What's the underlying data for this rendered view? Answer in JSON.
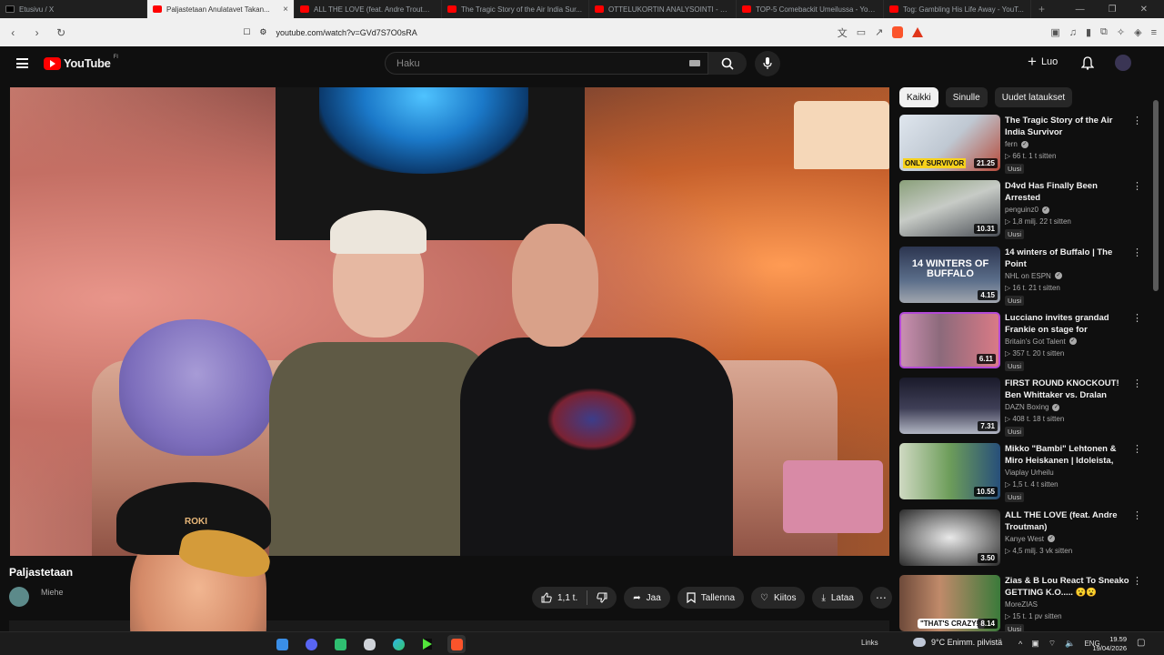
{
  "browser": {
    "tabs": [
      {
        "label": "Etusivu / X",
        "icon": "x-icon",
        "active": false
      },
      {
        "label": "Paljastetaan Anulatavet Takan...",
        "icon": "youtube-icon",
        "active": true
      },
      {
        "label": "ALL THE LOVE (feat. Andre Troutman...",
        "icon": "youtube-icon",
        "active": false
      },
      {
        "label": "The Tragic Story of the Air India Sur...",
        "icon": "youtube-icon",
        "active": false
      },
      {
        "label": "OTTELUKORTIN ANALYSOINTI - YouT...",
        "icon": "youtube-icon",
        "active": false
      },
      {
        "label": "TOP-5 Comebackit Umeilussa - YouT...",
        "icon": "youtube-icon",
        "active": false
      },
      {
        "label": "Tog: Gambling His Life Away - YouT...",
        "icon": "youtube-icon",
        "active": false
      }
    ],
    "new_tab": "+",
    "url": "youtube.com/watch?v=GVd7S7O0sRA"
  },
  "header": {
    "logo_text": "YouTube",
    "region": "FI",
    "search_placeholder": "Haku",
    "create_label": "Luo"
  },
  "video": {
    "title": "Paljastetaan",
    "channel": "Miehe",
    "webcam_cap_text": "ROKI",
    "actions": {
      "likes": "1,1 t.",
      "share": "Jaa",
      "save": "Tallenna",
      "thanks": "Kiitos",
      "download": "Lataa"
    }
  },
  "sidebar": {
    "chips": [
      "Kaikki",
      "Sinulle",
      "Uudet lataukset"
    ],
    "recommendations": [
      {
        "title": "The Tragic Story of the Air India Survivor",
        "channel": "fern",
        "verified": true,
        "meta": "▷ 66 t.  1 t sitten",
        "badge": "Uusi",
        "duration": "21.25",
        "thumb_label": "ONLY SURVIVOR"
      },
      {
        "title": "D4vd Has Finally Been Arrested",
        "channel": "penguinz0",
        "verified": true,
        "meta": "▷ 1,8 milj.  22 t sitten",
        "badge": "Uusi",
        "duration": "10.31",
        "thumb_label": ""
      },
      {
        "title": "14 winters of Buffalo | The Point",
        "channel": "NHL on ESPN",
        "verified": true,
        "meta": "▷ 16 t.  21 t sitten",
        "badge": "Uusi",
        "duration": "4.15",
        "thumb_label": "14 WINTERS OF BUFFALO"
      },
      {
        "title": "Lucciano invites grandad Frankie on stage for emotiona...",
        "channel": "Britain's Got Talent",
        "verified": true,
        "meta": "▷ 357 t.  20 t sitten",
        "badge": "Uusi",
        "duration": "6.11",
        "thumb_label": ""
      },
      {
        "title": "FIRST ROUND KNOCKOUT! Ben Whittaker vs. Dralan Suarez | ...",
        "channel": "DAZN Boxing",
        "verified": true,
        "meta": "▷ 408 t.  18 t sitten",
        "badge": "Uusi",
        "duration": "7.31",
        "thumb_label": ""
      },
      {
        "title": "Mikko \"Bambi\" Lehtonen & Miro Heiskanen | Idoleista, urasta &...",
        "channel": "Viaplay Urheilu",
        "verified": false,
        "meta": "▷ 1,5 t.  4 t sitten",
        "badge": "Uusi",
        "duration": "10.55",
        "thumb_label": ""
      },
      {
        "title": "ALL THE LOVE (feat. Andre Troutman)",
        "channel": "Kanye West",
        "verified": true,
        "meta": "▷ 4,5 milj.  3 vk sitten",
        "badge": "",
        "duration": "3.50",
        "thumb_label": ""
      },
      {
        "title": "Zias & B Lou React To Sneako GETTING K.O..... 😮😮",
        "channel": "MoreZIAS",
        "verified": false,
        "meta": "▷ 15 t.  1 pv sitten",
        "badge": "Uusi",
        "duration": "8.14",
        "thumb_label": "\"THAT'S CRAZY!\""
      }
    ]
  },
  "taskbar": {
    "links": "Links",
    "weather": "9°C  Enimm. pilvistä",
    "lang": "ENG",
    "time": "19.59",
    "date": "19/04/2026"
  },
  "colors": {
    "brand_red": "#ff0000",
    "background": "#0f0f0f",
    "chip_bg": "#272727"
  }
}
